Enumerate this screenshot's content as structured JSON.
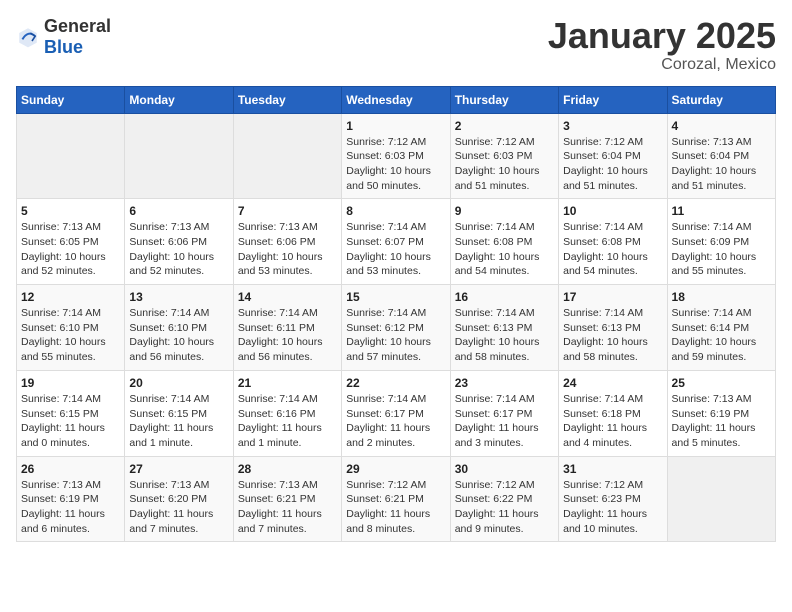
{
  "header": {
    "logo_general": "General",
    "logo_blue": "Blue",
    "title": "January 2025",
    "subtitle": "Corozal, Mexico"
  },
  "weekdays": [
    "Sunday",
    "Monday",
    "Tuesday",
    "Wednesday",
    "Thursday",
    "Friday",
    "Saturday"
  ],
  "weeks": [
    [
      {
        "day": "",
        "info": ""
      },
      {
        "day": "",
        "info": ""
      },
      {
        "day": "",
        "info": ""
      },
      {
        "day": "1",
        "info": "Sunrise: 7:12 AM\nSunset: 6:03 PM\nDaylight: 10 hours\nand 50 minutes."
      },
      {
        "day": "2",
        "info": "Sunrise: 7:12 AM\nSunset: 6:03 PM\nDaylight: 10 hours\nand 51 minutes."
      },
      {
        "day": "3",
        "info": "Sunrise: 7:12 AM\nSunset: 6:04 PM\nDaylight: 10 hours\nand 51 minutes."
      },
      {
        "day": "4",
        "info": "Sunrise: 7:13 AM\nSunset: 6:04 PM\nDaylight: 10 hours\nand 51 minutes."
      }
    ],
    [
      {
        "day": "5",
        "info": "Sunrise: 7:13 AM\nSunset: 6:05 PM\nDaylight: 10 hours\nand 52 minutes."
      },
      {
        "day": "6",
        "info": "Sunrise: 7:13 AM\nSunset: 6:06 PM\nDaylight: 10 hours\nand 52 minutes."
      },
      {
        "day": "7",
        "info": "Sunrise: 7:13 AM\nSunset: 6:06 PM\nDaylight: 10 hours\nand 53 minutes."
      },
      {
        "day": "8",
        "info": "Sunrise: 7:14 AM\nSunset: 6:07 PM\nDaylight: 10 hours\nand 53 minutes."
      },
      {
        "day": "9",
        "info": "Sunrise: 7:14 AM\nSunset: 6:08 PM\nDaylight: 10 hours\nand 54 minutes."
      },
      {
        "day": "10",
        "info": "Sunrise: 7:14 AM\nSunset: 6:08 PM\nDaylight: 10 hours\nand 54 minutes."
      },
      {
        "day": "11",
        "info": "Sunrise: 7:14 AM\nSunset: 6:09 PM\nDaylight: 10 hours\nand 55 minutes."
      }
    ],
    [
      {
        "day": "12",
        "info": "Sunrise: 7:14 AM\nSunset: 6:10 PM\nDaylight: 10 hours\nand 55 minutes."
      },
      {
        "day": "13",
        "info": "Sunrise: 7:14 AM\nSunset: 6:10 PM\nDaylight: 10 hours\nand 56 minutes."
      },
      {
        "day": "14",
        "info": "Sunrise: 7:14 AM\nSunset: 6:11 PM\nDaylight: 10 hours\nand 56 minutes."
      },
      {
        "day": "15",
        "info": "Sunrise: 7:14 AM\nSunset: 6:12 PM\nDaylight: 10 hours\nand 57 minutes."
      },
      {
        "day": "16",
        "info": "Sunrise: 7:14 AM\nSunset: 6:13 PM\nDaylight: 10 hours\nand 58 minutes."
      },
      {
        "day": "17",
        "info": "Sunrise: 7:14 AM\nSunset: 6:13 PM\nDaylight: 10 hours\nand 58 minutes."
      },
      {
        "day": "18",
        "info": "Sunrise: 7:14 AM\nSunset: 6:14 PM\nDaylight: 10 hours\nand 59 minutes."
      }
    ],
    [
      {
        "day": "19",
        "info": "Sunrise: 7:14 AM\nSunset: 6:15 PM\nDaylight: 11 hours\nand 0 minutes."
      },
      {
        "day": "20",
        "info": "Sunrise: 7:14 AM\nSunset: 6:15 PM\nDaylight: 11 hours\nand 1 minute."
      },
      {
        "day": "21",
        "info": "Sunrise: 7:14 AM\nSunset: 6:16 PM\nDaylight: 11 hours\nand 1 minute."
      },
      {
        "day": "22",
        "info": "Sunrise: 7:14 AM\nSunset: 6:17 PM\nDaylight: 11 hours\nand 2 minutes."
      },
      {
        "day": "23",
        "info": "Sunrise: 7:14 AM\nSunset: 6:17 PM\nDaylight: 11 hours\nand 3 minutes."
      },
      {
        "day": "24",
        "info": "Sunrise: 7:14 AM\nSunset: 6:18 PM\nDaylight: 11 hours\nand 4 minutes."
      },
      {
        "day": "25",
        "info": "Sunrise: 7:13 AM\nSunset: 6:19 PM\nDaylight: 11 hours\nand 5 minutes."
      }
    ],
    [
      {
        "day": "26",
        "info": "Sunrise: 7:13 AM\nSunset: 6:19 PM\nDaylight: 11 hours\nand 6 minutes."
      },
      {
        "day": "27",
        "info": "Sunrise: 7:13 AM\nSunset: 6:20 PM\nDaylight: 11 hours\nand 7 minutes."
      },
      {
        "day": "28",
        "info": "Sunrise: 7:13 AM\nSunset: 6:21 PM\nDaylight: 11 hours\nand 7 minutes."
      },
      {
        "day": "29",
        "info": "Sunrise: 7:12 AM\nSunset: 6:21 PM\nDaylight: 11 hours\nand 8 minutes."
      },
      {
        "day": "30",
        "info": "Sunrise: 7:12 AM\nSunset: 6:22 PM\nDaylight: 11 hours\nand 9 minutes."
      },
      {
        "day": "31",
        "info": "Sunrise: 7:12 AM\nSunset: 6:23 PM\nDaylight: 11 hours\nand 10 minutes."
      },
      {
        "day": "",
        "info": ""
      }
    ]
  ]
}
